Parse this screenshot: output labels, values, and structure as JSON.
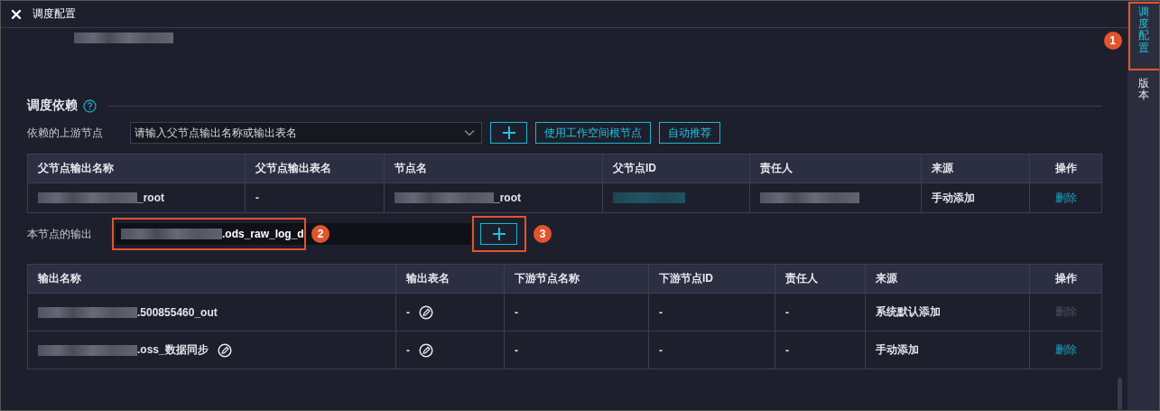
{
  "window": {
    "title": "调度配置"
  },
  "header": {
    "redacted": true
  },
  "section": {
    "title": "调度依赖"
  },
  "upstream": {
    "label": "依赖的上游节点",
    "placeholder": "请输入父节点输出名称或输出表名",
    "buttons": [
      {
        "kind": "add"
      },
      {
        "kind": "text",
        "label": "使用工作空间根节点"
      },
      {
        "kind": "text",
        "label": "自动推荐"
      }
    ]
  },
  "parents_table": {
    "columns": [
      "父节点输出名称",
      "父节点输出表名",
      "节点名",
      "父节点ID",
      "责任人",
      "来源",
      "操作"
    ],
    "rows": [
      [
        {
          "text": "_root",
          "redacted": true
        },
        {
          "text": "-"
        },
        {
          "text": "_root",
          "redacted": true
        },
        {
          "redacted": true,
          "link": true
        },
        {
          "redacted": true
        },
        {
          "text": "手动添加"
        },
        {
          "text": "删除",
          "kind": "action",
          "disabled": false
        }
      ]
    ]
  },
  "output": {
    "label": "本节点的输出",
    "value": ".ods_raw_log_d",
    "redacted": true,
    "callout": "2",
    "add_callout": "3"
  },
  "outputs_table": {
    "columns": [
      "输出名称",
      "输出表名",
      "下游节点名称",
      "下游节点ID",
      "责任人",
      "来源",
      "操作"
    ],
    "rows": [
      [
        {
          "text": ".500855460_out",
          "redacted": true
        },
        {
          "text": "-",
          "editable": true
        },
        {
          "text": "-"
        },
        {
          "text": "-"
        },
        {
          "text": "-"
        },
        {
          "text": "系统默认添加"
        },
        {
          "text": "删除",
          "kind": "action",
          "disabled": true
        }
      ],
      [
        {
          "text": ".oss_数据同步",
          "redacted": true,
          "editable": true
        },
        {
          "text": "-",
          "editable": true
        },
        {
          "text": "-"
        },
        {
          "text": "-"
        },
        {
          "text": "-"
        },
        {
          "text": "手动添加"
        },
        {
          "text": "删除",
          "kind": "action",
          "disabled": false
        }
      ]
    ]
  },
  "sidebar": {
    "items": [
      {
        "label": "调度配置",
        "selected": true,
        "callout": "1"
      },
      {
        "label": "版本",
        "selected": false
      }
    ]
  }
}
